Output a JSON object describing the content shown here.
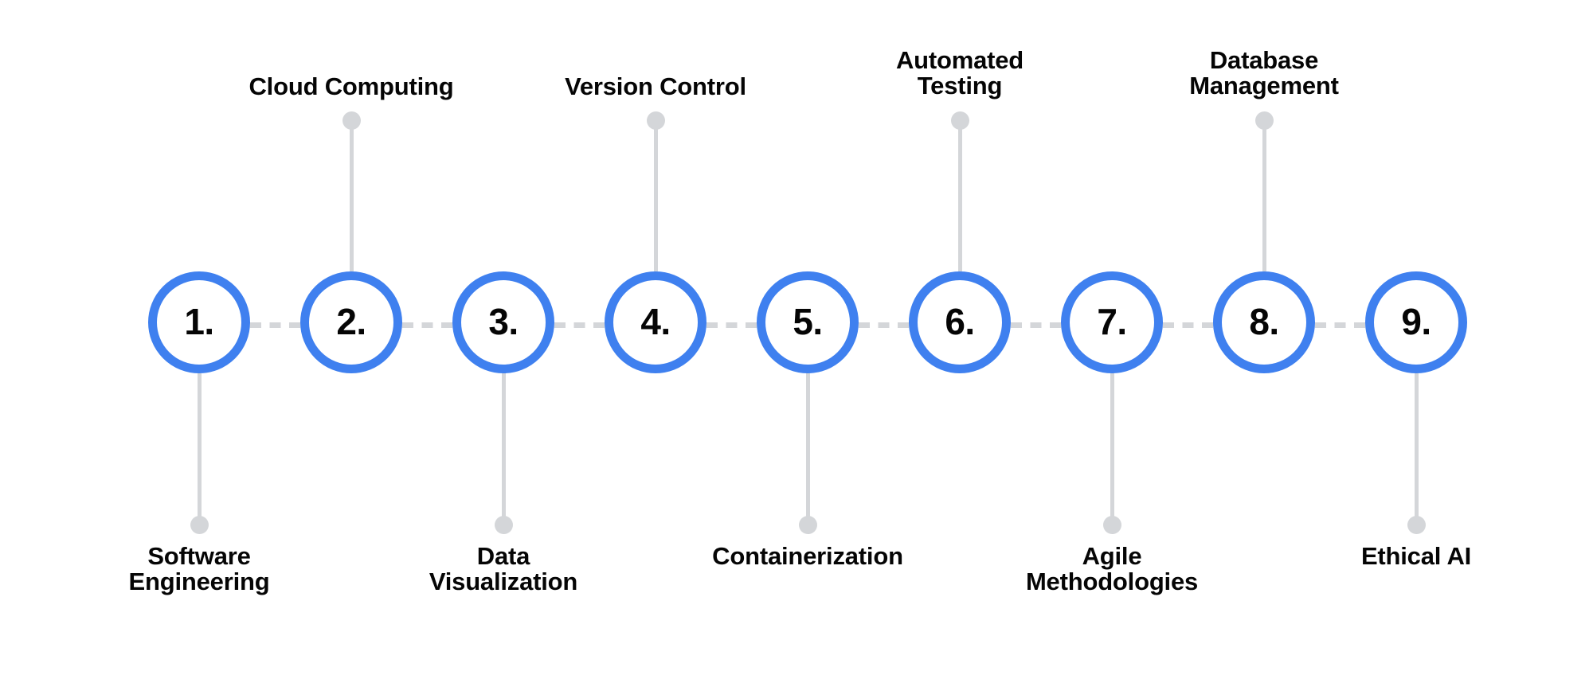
{
  "diagram": {
    "type": "horizontal-numbered-timeline",
    "background_color": "#ffffff",
    "accent_color": "#3f80ef",
    "connector_color": "#d4d6d9",
    "text_color": "#050505",
    "step_count": 9,
    "steps": [
      {
        "number": "1.",
        "label": "Software\nEngineering",
        "position": "below"
      },
      {
        "number": "2.",
        "label": "Cloud Computing",
        "position": "above"
      },
      {
        "number": "3.",
        "label": "Data\nVisualization",
        "position": "below"
      },
      {
        "number": "4.",
        "label": "Version Control",
        "position": "above"
      },
      {
        "number": "5.",
        "label": "Containerization",
        "position": "below"
      },
      {
        "number": "6.",
        "label": "Automated\nTesting",
        "position": "above"
      },
      {
        "number": "7.",
        "label": "Agile\nMethodologies",
        "position": "below"
      },
      {
        "number": "8.",
        "label": "Database\nManagement",
        "position": "above"
      },
      {
        "number": "9.",
        "label": "Ethical AI",
        "position": "below"
      }
    ]
  }
}
